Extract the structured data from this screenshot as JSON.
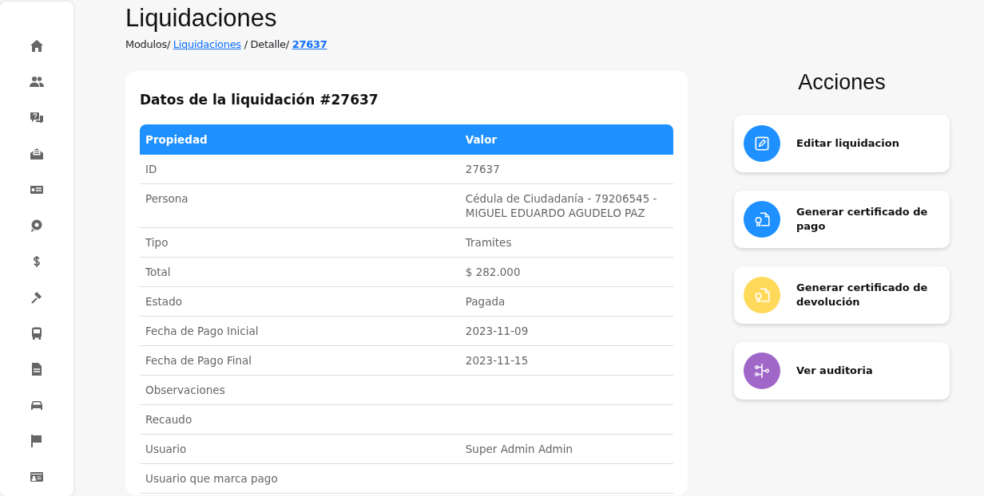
{
  "page_title": "Liquidaciones",
  "breadcrumb": [
    {
      "label": "Modulos/",
      "kind": "text"
    },
    {
      "label": "Liquidaciones",
      "kind": "link"
    },
    {
      "label": "/ Detalle/",
      "kind": "text"
    },
    {
      "label": "27637",
      "kind": "current"
    }
  ],
  "details_card": {
    "title": "Datos de la liquidación #27637",
    "table": {
      "columns": [
        "Propiedad",
        "Valor"
      ],
      "rows": [
        {
          "property": "ID",
          "value": "27637"
        },
        {
          "property": "Persona",
          "value": "Cédula de Ciudadanía - 79206545 - MIGUEL EDUARDO AGUDELO PAZ"
        },
        {
          "property": "Tipo",
          "value": "Tramites"
        },
        {
          "property": "Total",
          "value": "$ 282.000"
        },
        {
          "property": "Estado",
          "value": "Pagada"
        },
        {
          "property": "Fecha de Pago Inicial",
          "value": "2023-11-09"
        },
        {
          "property": "Fecha de Pago Final",
          "value": "2023-11-15"
        },
        {
          "property": "Observaciones"
        },
        {
          "property": "Recaudo"
        },
        {
          "property": "Usuario",
          "value": "Super Admin Admin"
        },
        {
          "property": "Usuario que marca pago"
        }
      ]
    }
  },
  "actions": {
    "title": "Acciones",
    "items": [
      {
        "label": "Editar liquidacion",
        "color": "#1e90ff",
        "kind": "edit"
      },
      {
        "label": "Generar certificado de pago",
        "color": "#1e90ff",
        "kind": "certificate"
      },
      {
        "label": "Generar certificado de devolución",
        "color": "#ffd95a",
        "kind": "certificate"
      },
      {
        "label": "Ver auditoria",
        "color": "#a066c8",
        "kind": "audit"
      }
    ]
  }
}
